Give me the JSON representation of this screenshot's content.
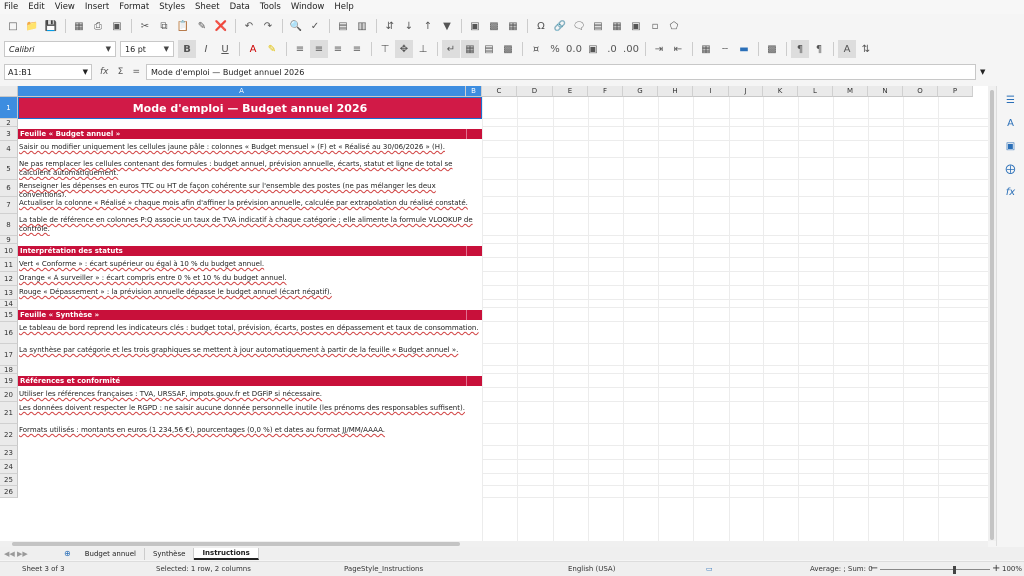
{
  "menu": [
    "File",
    "Edit",
    "View",
    "Insert",
    "Format",
    "Styles",
    "Sheet",
    "Data",
    "Tools",
    "Window",
    "Help"
  ],
  "font": {
    "name": "Calibri",
    "size": "16 pt"
  },
  "formula_bar": {
    "cell_ref": "A1:B1",
    "content": "Mode d'emploi — Budget annuel 2026"
  },
  "columns": [
    "A",
    "B",
    "C",
    "D",
    "E",
    "F",
    "G",
    "H",
    "I",
    "J",
    "K",
    "L",
    "M",
    "N",
    "O",
    "P"
  ],
  "rows": [
    "1",
    "2",
    "3",
    "4",
    "5",
    "6",
    "7",
    "8",
    "9",
    "10",
    "11",
    "12",
    "13",
    "14",
    "15",
    "16",
    "17",
    "18",
    "19",
    "20",
    "21",
    "22",
    "23",
    "24",
    "25",
    "26"
  ],
  "title": "Mode d'emploi — Budget annuel 2026",
  "sections": {
    "budget": "Feuille « Budget annuel »",
    "statuts": "Interprétation des statuts",
    "synthese": "Feuille « Synthèse »",
    "references": "Références et conformité"
  },
  "lines": {
    "r4": "Saisir ou modifier uniquement les cellules jaune pâle : colonnes « Budget mensuel » (F) et « Réalisé au 30/06/2026 » (H).",
    "r5": "Ne pas remplacer les cellules contenant des formules : budget annuel, prévision annuelle, écarts, statut et ligne de total se calculent automatiquement.",
    "r6": "Renseigner les dépenses en euros TTC ou HT de façon cohérente sur l'ensemble des postes (ne pas mélanger les deux conventions).",
    "r7": "Actualiser la colonne « Réalisé » chaque mois afin d'affiner la prévision annuelle, calculée par extrapolation du réalisé constaté.",
    "r8": "La table de référence en colonnes P:Q associe un taux de TVA indicatif à chaque catégorie ; elle alimente la formule VLOOKUP de contrôle.",
    "r11": "Vert « Conforme » : écart supérieur ou égal à 10 % du budget annuel.",
    "r12": "Orange « À surveiller » : écart compris entre 0 % et 10 % du budget annuel.",
    "r13": "Rouge « Dépassement » : la prévision annuelle dépasse le budget annuel (écart négatif).",
    "r16": "Le tableau de bord reprend les indicateurs clés : budget total, prévision, écarts, postes en dépassement et taux de consommation.",
    "r17": "La synthèse par catégorie et les trois graphiques se mettent à jour automatiquement à partir de la feuille « Budget annuel ».",
    "r20": "Utiliser les références françaises : TVA, URSSAF, impots.gouv.fr et DGFiP si nécessaire.",
    "r21": "Les données doivent respecter le RGPD : ne saisir aucune donnée personnelle inutile (les prénoms des responsables suffisent).",
    "r22": "Formats utilisés : montants en euros (1 234,56 €), pourcentages (0,0 %) et dates au format JJ/MM/AAAA."
  },
  "tabs": [
    "Budget annuel",
    "Synthèse",
    "Instructions"
  ],
  "status": {
    "sheet": "Sheet 3 of 3",
    "selection": "Selected: 1 row, 2 columns",
    "pagestyle": "PageStyle_Instructions",
    "language": "English (USA)",
    "summary": "Average: ; Sum: 0",
    "zoom": "100%"
  },
  "colors": {
    "title_bg": "#d11a47",
    "band_bg": "#c8103a",
    "selection": "#3d8de0"
  }
}
